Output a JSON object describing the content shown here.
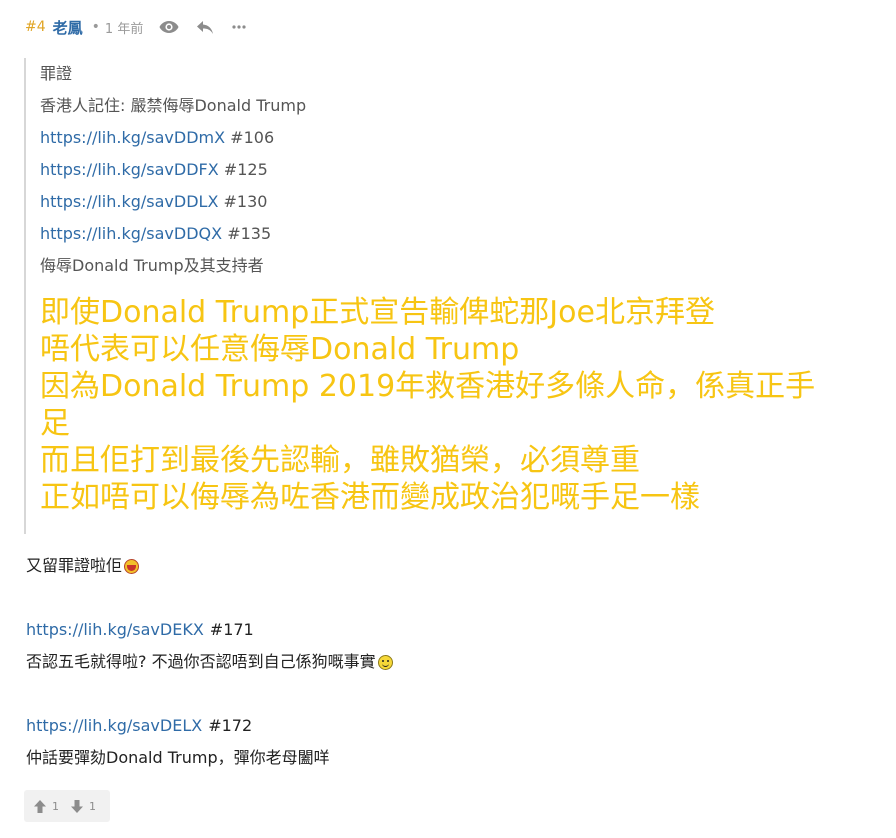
{
  "post": {
    "floor": "#4",
    "username": "老鳳",
    "separator": "•",
    "time": "1 年前",
    "icons": {
      "view": "eye-icon",
      "reply": "reply-icon",
      "more": "more-icon"
    }
  },
  "quote": {
    "lines": [
      {
        "text": "罪證"
      },
      {
        "text": "香港人記住: 嚴禁侮辱Donald Trump"
      },
      {
        "link": "https://lih.kg/savDDmX",
        "hash": "#106"
      },
      {
        "link": "https://lih.kg/savDDFX",
        "hash": "#125"
      },
      {
        "link": "https://lih.kg/savDDLX",
        "hash": "#130"
      },
      {
        "link": "https://lih.kg/savDDQX",
        "hash": "#135"
      },
      {
        "text": "侮辱Donald Trump及其支持者"
      }
    ],
    "big_lines": [
      "即使Donald Trump正式宣告輸俾蛇那Joe北京拜登",
      "唔代表可以任意侮辱Donald Trump",
      "因為Donald Trump 2019年救香港好多條人命，係真正手",
      "足",
      "而且佢打到最後先認輸，雖敗猶榮，必須尊重",
      "正如唔可以侮辱為咗香港而變成政治犯嘅手足一樣"
    ],
    "big_color": "#f7c513"
  },
  "body": {
    "line1": "又留罪證啦佢",
    "link1": "https://lih.kg/savDEKX",
    "hash1": "#171",
    "line2": "否認五毛就得啦? 不過你否認唔到自己係狗嘅事實",
    "link2": "https://lih.kg/savDELX",
    "hash2": "#172",
    "line3": "仲話要彈劾Donald Trump，彈你老母闔咩",
    "emoji1": "grin-emoji-icon",
    "emoji2": "smile-emoji-icon"
  },
  "votes": {
    "up": "1",
    "down": "1",
    "icons": {
      "up": "thumb-up-icon",
      "down": "thumb-down-icon"
    }
  },
  "colors": {
    "username": "#2f6ba7",
    "floor": "#e0a526",
    "link": "#2f6ba7",
    "meta": "#9a9a9a"
  }
}
